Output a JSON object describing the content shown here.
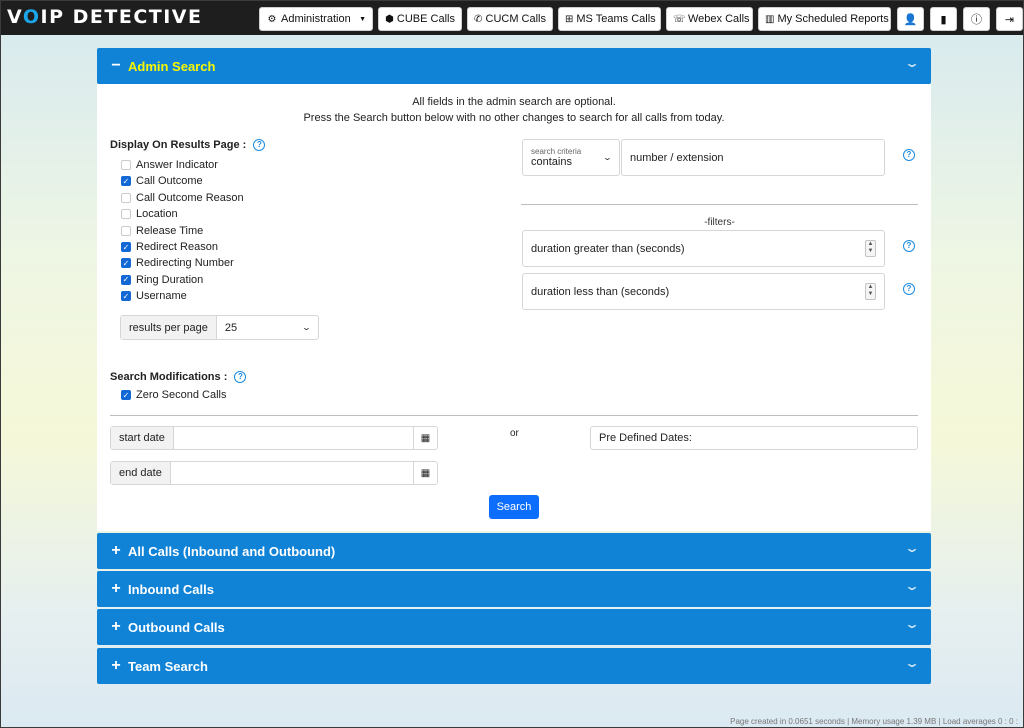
{
  "brand": {
    "part1": "V",
    "accent_o": "O",
    "part2": "IP ",
    "part3": "DETECTIVE"
  },
  "nav": {
    "administration": "Administration",
    "cube": "CUBE Calls",
    "cucm": "CUCM Calls",
    "teams": "MS Teams Calls",
    "webex": "Webex Calls",
    "reports": "My Scheduled Reports"
  },
  "admin": {
    "title": "Admin Search",
    "intro1": "All fields in the admin search are optional.",
    "intro2": "Press the Search button below with no other changes to search for all calls from today.",
    "display_title": "Display On Results Page :",
    "display_options": [
      {
        "label": "Answer Indicator",
        "checked": false
      },
      {
        "label": "Call Outcome",
        "checked": true
      },
      {
        "label": "Call Outcome Reason",
        "checked": false
      },
      {
        "label": "Location",
        "checked": false
      },
      {
        "label": "Release Time",
        "checked": false
      },
      {
        "label": "Redirect Reason",
        "checked": true
      },
      {
        "label": "Redirecting Number",
        "checked": true
      },
      {
        "label": "Ring Duration",
        "checked": true
      },
      {
        "label": "Username",
        "checked": true
      }
    ],
    "results_per_page_label": "results per page",
    "results_per_page_value": "25",
    "modifications_title": "Search Modifications :",
    "zero_second_calls": "Zero Second Calls",
    "criteria_label": "search criteria",
    "criteria_value": "contains",
    "number_placeholder": "number / extension",
    "filters_label": "-filters-",
    "duration_gt": "duration greater than (seconds)",
    "duration_lt": "duration less than (seconds)",
    "start_date_label": "start date",
    "end_date_label": "end date",
    "or_label": "or",
    "predefined_dates": "Pre Defined Dates:",
    "search_button": "Search"
  },
  "sections": {
    "all_calls": "All Calls (Inbound and Outbound)",
    "inbound": "Inbound Calls",
    "outbound": "Outbound Calls",
    "team": "Team Search"
  },
  "footer": "Page created in 0.0651 seconds | Memory usage 1.39 MB | Load averages 0 : 0 :",
  "colors": {
    "accent": "#1183d6",
    "admin_title": "#f7f700",
    "navbar": "#1e1e1e",
    "button": "#0d6efd"
  }
}
